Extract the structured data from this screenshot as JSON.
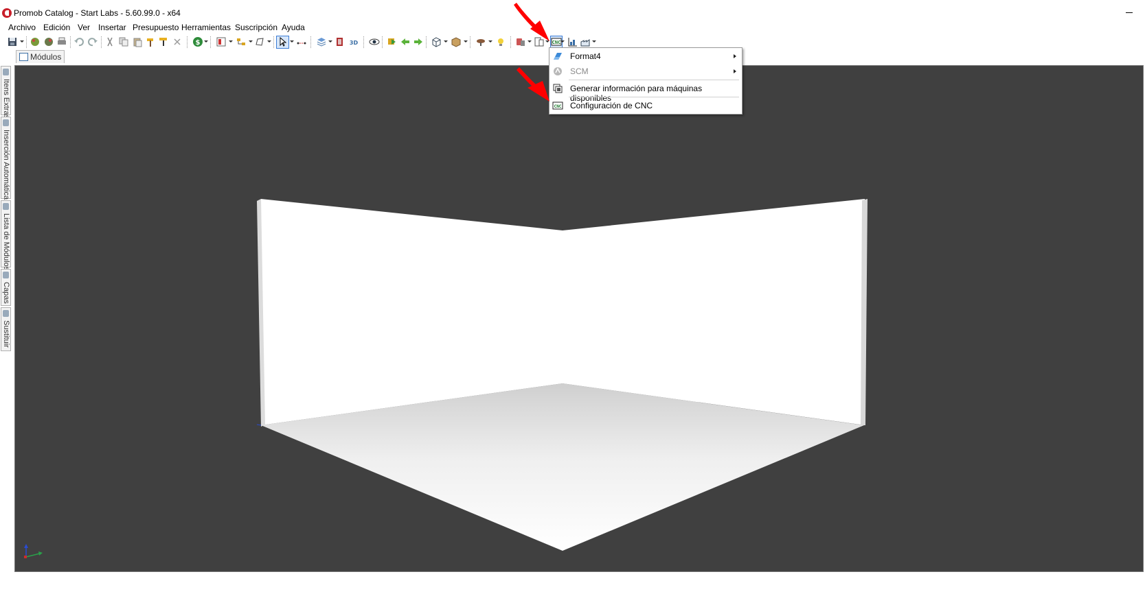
{
  "window": {
    "title": "Promob Catalog - Start Labs - 5.60.99.0 - x64"
  },
  "menubar": {
    "items": [
      "Archivo",
      "Edición",
      "Ver",
      "Insertar",
      "Presupuesto",
      "Herramientas",
      "Suscripción",
      "Ayuda"
    ]
  },
  "toolbar": {
    "cnc_label": "CNC",
    "three_d_label": "3D"
  },
  "doc_tab": {
    "label": "Módulos"
  },
  "side_tabs": [
    "Itens Extras",
    "Inserción Automática",
    "Lista de Módulos",
    "Capas",
    "Sustituir"
  ],
  "cnc_menu": {
    "items": [
      {
        "label": "Format4",
        "enabled": true,
        "has_submenu": true,
        "icon": "format4-icon"
      },
      {
        "label": "SCM",
        "enabled": false,
        "has_submenu": true,
        "icon": "scm-icon"
      },
      {
        "label": "Generar información para máquinas disponibles",
        "enabled": true,
        "has_submenu": false,
        "icon": "generate-icon"
      },
      {
        "label": "Configuración de CNC",
        "enabled": true,
        "has_submenu": false,
        "icon": "cnc-config-icon"
      }
    ]
  },
  "colors": {
    "viewport_bg": "#404040",
    "annotation_arrow": "#ff0000",
    "app_red": "#c8202b"
  }
}
